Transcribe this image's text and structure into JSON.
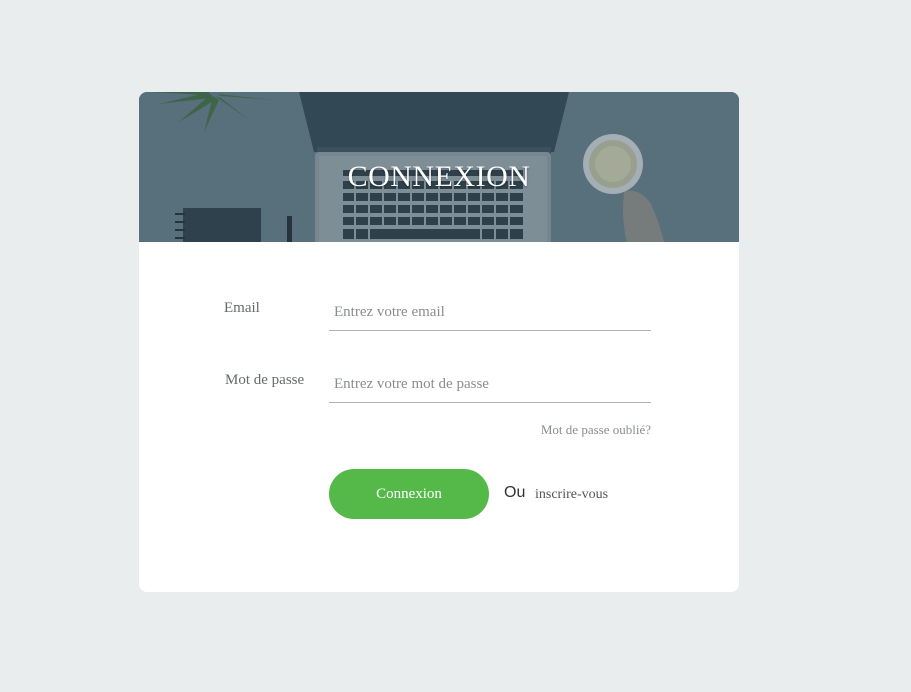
{
  "header": {
    "title": "CONNEXION"
  },
  "form": {
    "email_label": "Email",
    "email_placeholder": "Entrez votre email",
    "password_label": "Mot de passe",
    "password_placeholder": "Entrez votre mot de passe",
    "forgot_label": "Mot de passe oublié?",
    "submit_label": "Connexion",
    "or_label": "Ou",
    "signup_label": "inscrire-vous"
  },
  "colors": {
    "page_background": "#e9edee",
    "card_background": "#ffffff",
    "hero_background": "#5d7480",
    "button": "#55b94a"
  }
}
